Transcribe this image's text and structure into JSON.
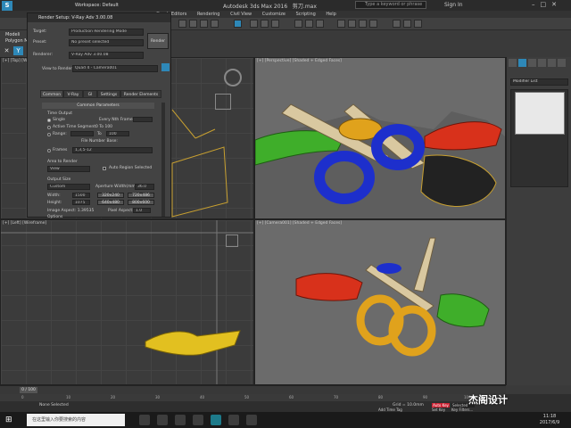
{
  "app": {
    "title": "Autodesk 3ds Max 2016",
    "file": "剪刀.max",
    "workspace": "Workspace: Default",
    "search_placeholder": "Type a keyword or phrase",
    "signin": "Sign In"
  },
  "menus": [
    "Graph Editors",
    "Rendering",
    "Civil View",
    "Customize",
    "Scripting",
    "Help"
  ],
  "ribbon": {
    "modeling": "Modeli",
    "polygon": "Polygon M"
  },
  "render_dialog": {
    "title": "Render Setup: V-Ray Adv 3.00.08",
    "target_label": "Target:",
    "target_value": "Production Rendering Mode",
    "preset_label": "Preset:",
    "preset_value": "No preset selected",
    "renderer_label": "Renderer:",
    "renderer_value": "V-Ray Adv 3.00.08",
    "view_label": "View to Render:",
    "view_value": "Quad 4 - Camera001",
    "render_button": "Render",
    "tabs": [
      "Common",
      "V-Ray",
      "GI",
      "Settings",
      "Render Elements"
    ],
    "common_params": "Common Parameters",
    "time_output": "Time Output",
    "single": "Single",
    "every_nth": "Every Nth Frame:",
    "active_segment": "Active Time Segment:",
    "active_range": "0 To 100",
    "range": "Range:",
    "range_to": "To",
    "range_end": "100",
    "file_number_base": "File Number Base:",
    "frames": "Frames",
    "frames_value": "1,3,5-12",
    "area_to_render": "Area to Render",
    "area_value": "View",
    "auto_region": "Auto Region Selected",
    "output_size": "Output Size",
    "output_preset": "Custom",
    "aperture": "Aperture Width(mm):",
    "aperture_value": "36.0",
    "width_label": "Width:",
    "width_value": "1500",
    "height_label": "Height:",
    "height_value": "1075",
    "size_presets": [
      "320x240",
      "720x486",
      "640x480",
      "800x600"
    ],
    "image_aspect": "Image Aspect: 1.39535",
    "pixel_aspect": "Pixel Aspect:",
    "pixel_aspect_value": "1.0",
    "options": "Options"
  },
  "viewports": {
    "top_left": "[+] [Top] [Wireframe]",
    "top_right": "[+] [Perspective] [Shaded + Edged Faces]",
    "bottom_left": "[+] [Left] [Wireframe]",
    "bottom_right": "[+] [Camera001] [Shaded + Edged Faces]"
  },
  "right_panel": {
    "modifier_list": "Modifier List"
  },
  "timeline": {
    "frame": "0 / 100",
    "ticks": [
      "0",
      "10",
      "20",
      "30",
      "40",
      "50",
      "60",
      "70",
      "80",
      "90",
      "100"
    ]
  },
  "status": {
    "selection": "None Selected",
    "grid": "Grid = 10.0mm",
    "add_time_tag": "Add Time Tag",
    "key_filters": "Key Filters...",
    "selected": "Selected",
    "auto_key": "Auto Key",
    "set_key": "Set Key"
  },
  "taskbar": {
    "search": "在这里输入你要搜索的内容",
    "time": "11:18",
    "date": "2017/6/9"
  },
  "watermark": "杰阁设计",
  "colors": {
    "accent_blue": "#2e88b8",
    "scissor_red": "#d8311b",
    "scissor_green": "#3fae2a",
    "scissor_blue": "#1d2fcc",
    "scissor_yellow": "#e0a21c",
    "scissor_black": "#222222"
  }
}
